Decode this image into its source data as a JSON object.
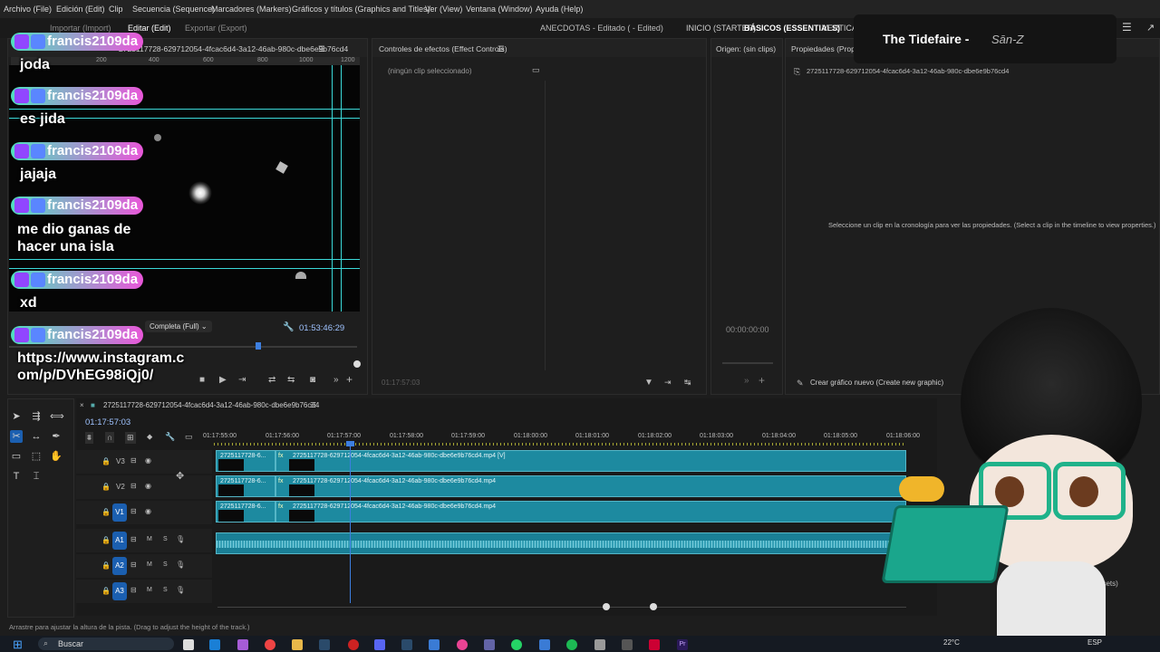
{
  "menu": {
    "items": [
      "Archivo (File)",
      "Edición (Edit)",
      "Clip",
      "Secuencia (Sequence)",
      "Marcadores (Markers)",
      "Gráficos y títulos (Graphics and Titles)",
      "Ver (View)",
      "Ventana (Window)",
      "Ayuda (Help)"
    ]
  },
  "workspace": {
    "import": "Importar (Import)",
    "edit": "Editar (Edit)",
    "export": "Exportar (Export)",
    "project_title": "ANECDOTAS - Editado ( - Edited)",
    "starter": "INICIO (STARTER)",
    "essentials": "BÁSICOS (ESSENTIALS)",
    "vertical": "VERTICAL"
  },
  "program_monitor": {
    "title": "2725117728-629712054-4fcac6d4-3a12-46ab-980c-dbe6e9b76cd4",
    "ruler_ticks": [
      "200",
      "400",
      "600",
      "800",
      "1000",
      "1200"
    ],
    "quality": "Completa (Full)",
    "timecode": "01:53:46:29"
  },
  "effect_controls": {
    "title": "Controles de efectos (Effect Controls)",
    "empty": "(ningún clip seleccionado)",
    "timecode": "01:17:57:03"
  },
  "source": {
    "title": "Origen: (sin clips)",
    "timecode": "00:00:00:00"
  },
  "properties": {
    "title": "Propiedades (Proper",
    "clip_name": "2725117728-629712054-4fcac6d4-3a12-46ab-980c-dbe6e9b76cd4",
    "hint": "Seleccione un clip en la cronología para ver las propiedades. (Select a clip in the timeline to view properties.)",
    "new_graphic": "Crear gráfico nuevo (Create new graphic)",
    "presets": "Presets)"
  },
  "timeline": {
    "sequence_name": "2725117728-629712054-4fcac6d4-3a12-46ab-980c-dbe6e9b76cd4",
    "timecode": "01:17:57:03",
    "ruler": [
      "01:17:55:00",
      "01:17:56:00",
      "01:17:57:00",
      "01:17:58:00",
      "01:17:59:00",
      "01:18:00:00",
      "01:18:01:00",
      "01:18:02:00",
      "01:18:03:00",
      "01:18:04:00",
      "01:18:05:00",
      "01:18:06:00"
    ],
    "tracks_video": [
      "V3",
      "V2",
      "V1"
    ],
    "tracks_audio": [
      "A1",
      "A2",
      "A3"
    ],
    "audio_letters": [
      "M",
      "S"
    ],
    "clip_short": "2725117728-6...",
    "clip_v3": "2725117728-629712054-4fcac6d4-3a12-46ab-980c-dbe6e9b76cd4.mp4 [V]",
    "clip_v2": "2725117728-629712054-4fcac6d4-3a12-46ab-980c-dbe6e9b76cd4.mp4",
    "clip_v1": "2725117728-629712054-4fcac6d4-3a12-46ab-980c-dbe6e9b76cd4.mp4",
    "fx": "fx"
  },
  "status_bar": "Arrastre para ajustar la altura de la pista. (Drag to adjust the height of the track.)",
  "taskbar": {
    "search": "Buscar",
    "temp": "22°C",
    "lang": "ESP"
  },
  "stream_overlay": {
    "now_playing_title": "The Tidefaire -",
    "now_playing_artist": "Sān-Z"
  },
  "chat": [
    {
      "user": "francis2109da",
      "message": "joda"
    },
    {
      "user": "francis2109da",
      "message": "es jida"
    },
    {
      "user": "francis2109da",
      "message": "jajaja"
    },
    {
      "user": "francis2109da",
      "message": "me dio ganas de hacer una isla"
    },
    {
      "user": "francis2109da",
      "message": "xd"
    },
    {
      "user": "francis2109da",
      "message": "https://www.instagram.com/p/DVhEG98iQj0/"
    }
  ],
  "colors": {
    "clip": "#1d8aa0",
    "track_label": "#1b5fb0",
    "badge_start": "#4fe0c0",
    "badge_end": "#e957d9",
    "guide": "#3bd9d9",
    "playhead": "#3d7fe0"
  }
}
